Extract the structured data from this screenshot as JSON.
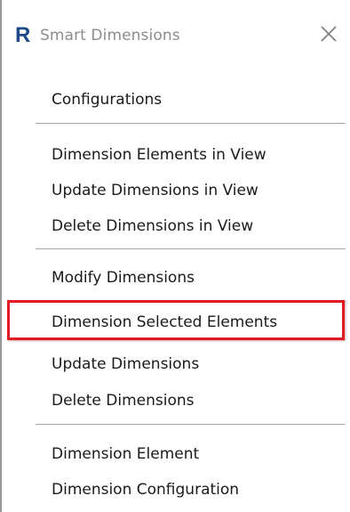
{
  "window": {
    "title": "Smart Dimensions",
    "app_icon_letter": "R",
    "close_glyph": "close-icon"
  },
  "colors": {
    "accent_icon": "#1d4a86",
    "highlight_border": "#e31b23",
    "separator": "#a8a8a8",
    "title_text": "#8c8c8c"
  },
  "menu": {
    "configurations": "Configurations",
    "dimension_elements_in_view": "Dimension Elements in View",
    "update_dimensions_in_view": "Update Dimensions in View",
    "delete_dimensions_in_view": "Delete Dimensions in View",
    "modify_dimensions": "Modify Dimensions",
    "dimension_selected_elements": "Dimension Selected Elements",
    "update_dimensions": "Update Dimensions",
    "delete_dimensions": "Delete Dimensions",
    "dimension_element": "Dimension Element",
    "dimension_configuration": "Dimension Configuration"
  }
}
